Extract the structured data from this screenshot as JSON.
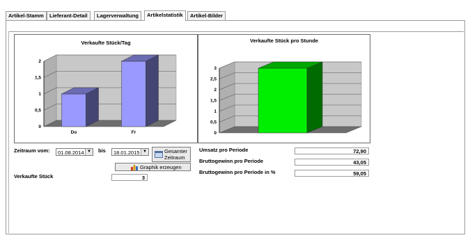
{
  "tabs": [
    {
      "label": "Artikel-Stamm"
    },
    {
      "label": "Lieferant-Detail"
    },
    {
      "label": "Lagerverwaltung"
    },
    {
      "label": "Artikelstatistik"
    },
    {
      "label": "Artikel-Bilder"
    }
  ],
  "chart_data": [
    {
      "type": "bar",
      "title": "Verkaufte Stück/Tag",
      "categories": [
        "Do",
        "Fr"
      ],
      "values": [
        1,
        2
      ],
      "ylim": [
        0,
        2
      ],
      "yticks": [
        "0",
        "0,5",
        "1",
        "1,5",
        "2"
      ],
      "color": "#9999ff"
    },
    {
      "type": "bar",
      "title": "Verkaufte Stück pro Stunde",
      "categories": [
        ""
      ],
      "values": [
        3
      ],
      "ylim": [
        0,
        3
      ],
      "yticks": [
        "0",
        "0,5",
        "1",
        "1,5",
        "2",
        "2,5",
        "3"
      ],
      "color": "#00ee00"
    }
  ],
  "form": {
    "zeitraum_label": "Zeitraum vom:",
    "from_date": "01.08.2014",
    "bis_label": "bis",
    "to_date": "18.01.2015",
    "gesamter_line1": "Gesamter",
    "gesamter_line2": "Zeitraum",
    "graphik_label": "Graphik erzeugen",
    "verkaufte_label": "Verkaufte Stück",
    "verkaufte_value": "3"
  },
  "stats": [
    {
      "label": "Umsatz pro Periode",
      "value": "72,90"
    },
    {
      "label": "Bruttogewinn pro Periode",
      "value": "43,05"
    },
    {
      "label": "Bruttogewinn pro Periode in %",
      "value": "59,05"
    }
  ]
}
